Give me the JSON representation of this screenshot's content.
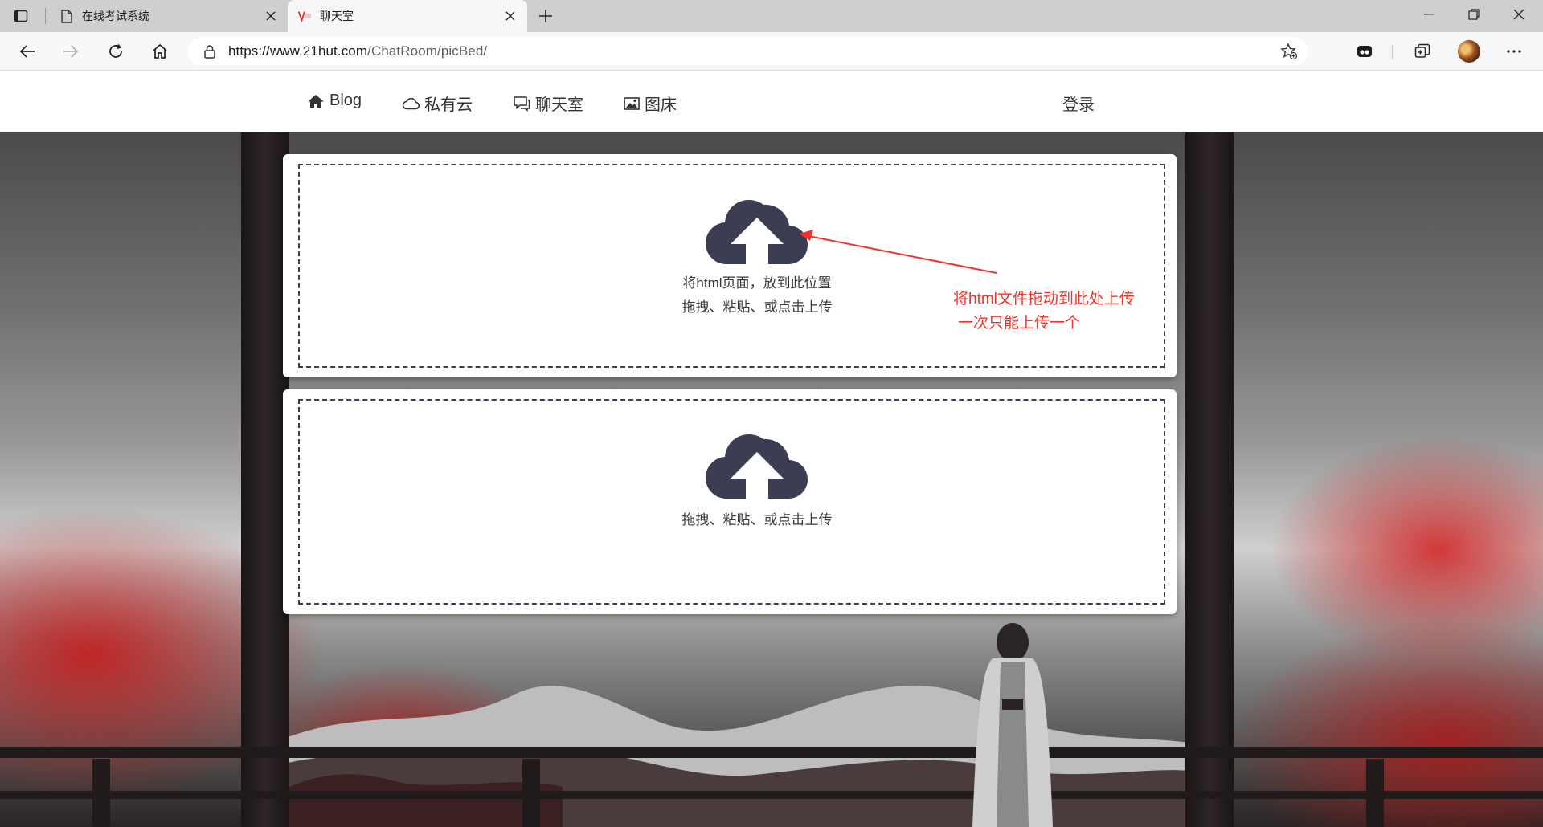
{
  "browser": {
    "tabs": [
      {
        "title": "在线考试系统",
        "active": false
      },
      {
        "title": "聊天室",
        "active": true
      }
    ],
    "url_host": "https://www.21hut.com",
    "url_path": "/ChatRoom/picBed/"
  },
  "nav": {
    "items": [
      {
        "label": "Blog",
        "icon": "home-icon"
      },
      {
        "label": "私有云",
        "icon": "cloud-icon"
      },
      {
        "label": "聊天室",
        "icon": "chat-icon"
      },
      {
        "label": "图床",
        "icon": "image-icon"
      }
    ],
    "login_label": "登录"
  },
  "upload_html": {
    "line1": "将html页面，放到此位置",
    "line2": "拖拽、粘贴、或点击上传"
  },
  "upload_image": {
    "line1": "拖拽、粘贴、或点击上传"
  },
  "annotation": {
    "line1": "将html文件拖动到此处上传",
    "line2": "一次只能上传一个",
    "color": "#f0322a"
  },
  "colors": {
    "cloud_icon": "#3b3d52",
    "dropzone_border": "#3b3d52"
  }
}
